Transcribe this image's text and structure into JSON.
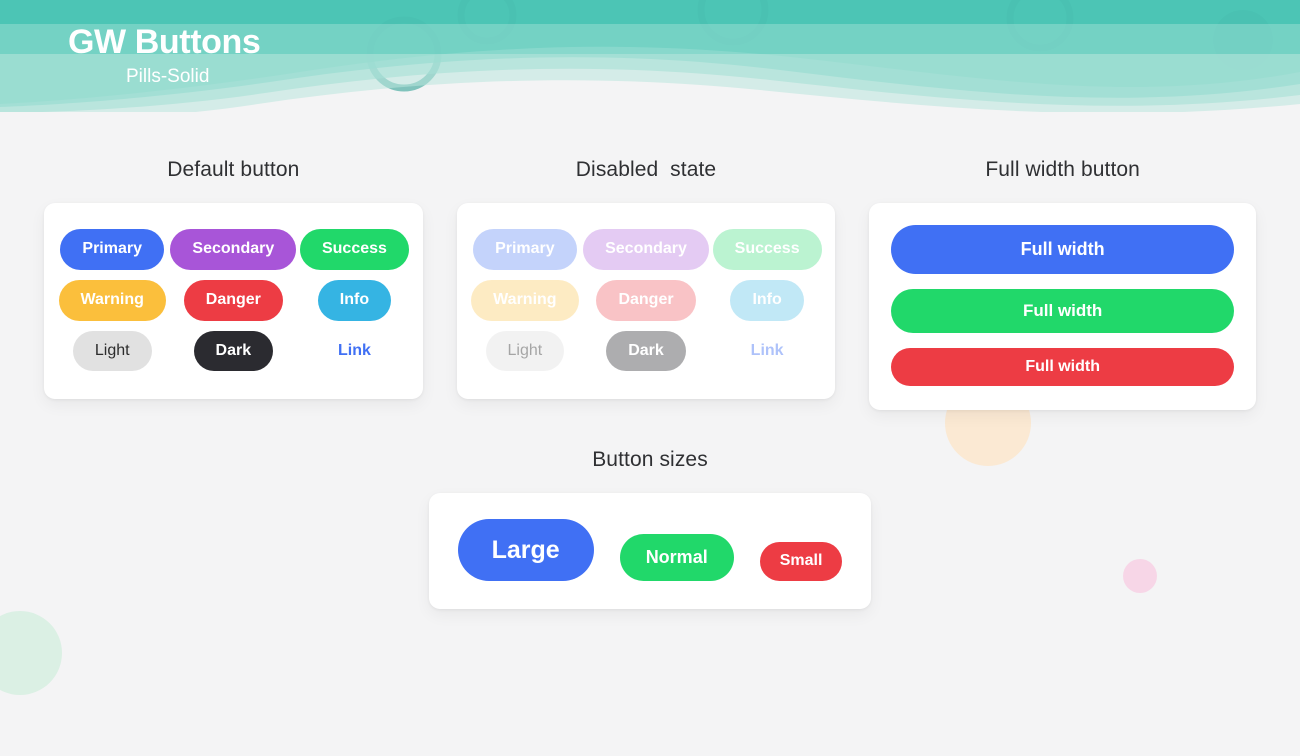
{
  "header": {
    "title": "GW Buttons",
    "subtitle": "Pills-Solid",
    "wave_colors": {
      "base": "#2cb9a8",
      "mid": "#57c9ba",
      "light": "#8fdace",
      "pale": "#b9e6dd"
    }
  },
  "colors": {
    "primary": "#4070f4",
    "secondary": "#a855d8",
    "success": "#21d86a",
    "warning": "#fbbf3c",
    "danger": "#ed3c44",
    "info": "#35b4e3",
    "light": "#e1e1e1",
    "dark": "#2b2b30",
    "link": "#4070f4",
    "page_bg": "#f4f4f5",
    "card_bg": "#ffffff",
    "heading": "#2f3033"
  },
  "sections": {
    "default": {
      "title": "Default button",
      "buttons": [
        {
          "label": "Primary",
          "variant": "primary"
        },
        {
          "label": "Secondary",
          "variant": "secondary"
        },
        {
          "label": "Success",
          "variant": "success"
        },
        {
          "label": "Warning",
          "variant": "warning"
        },
        {
          "label": "Danger",
          "variant": "danger"
        },
        {
          "label": "Info",
          "variant": "info"
        },
        {
          "label": "Light",
          "variant": "light"
        },
        {
          "label": "Dark",
          "variant": "dark"
        },
        {
          "label": "Link",
          "variant": "link"
        }
      ]
    },
    "disabled": {
      "title": "Disabled  state",
      "buttons": [
        {
          "label": "Primary",
          "variant": "primary"
        },
        {
          "label": "Secondary",
          "variant": "secondary"
        },
        {
          "label": "Success",
          "variant": "success"
        },
        {
          "label": "Warning",
          "variant": "warning"
        },
        {
          "label": "Danger",
          "variant": "danger"
        },
        {
          "label": "Info",
          "variant": "info"
        },
        {
          "label": "Light",
          "variant": "light"
        },
        {
          "label": "Dark",
          "variant": "dark"
        },
        {
          "label": "Link",
          "variant": "link"
        }
      ]
    },
    "fullwidth": {
      "title": "Full width button",
      "buttons": [
        {
          "label": "Full width",
          "variant": "primary",
          "size": "large"
        },
        {
          "label": "Full width",
          "variant": "success",
          "size": "medium"
        },
        {
          "label": "Full width",
          "variant": "danger",
          "size": "small"
        }
      ]
    },
    "sizes": {
      "title": "Button sizes",
      "buttons": [
        {
          "label": "Large",
          "variant": "primary",
          "size": "large"
        },
        {
          "label": "Normal",
          "variant": "success",
          "size": "normal"
        },
        {
          "label": "Small",
          "variant": "danger",
          "size": "small"
        }
      ]
    }
  }
}
